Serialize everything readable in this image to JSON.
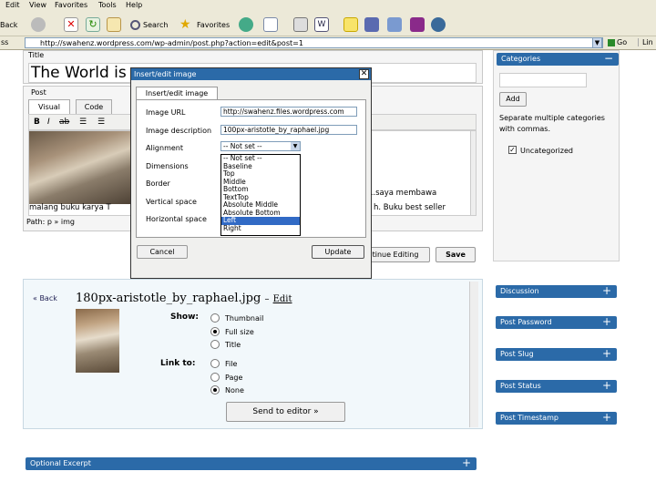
{
  "menubar": [
    "Edit",
    "View",
    "Favorites",
    "Tools",
    "Help"
  ],
  "toolbar": {
    "back_label": "Back",
    "search_label": "Search",
    "favorites_label": "Favorites",
    "go_label": "Go",
    "links_label": "Lin"
  },
  "address": {
    "label": "ss",
    "url": "http://swahenz.wordpress.com/wp-admin/post.php?action=edit&post=1"
  },
  "editor": {
    "title_label": "Title",
    "post_title": "The World is",
    "post_label": "Post",
    "tab_visual": "Visual",
    "tab_code": "Code",
    "body_line1": "...saya membawa",
    "body_line2": "malang buku karya T",
    "body_line3": "h. Buku best seller",
    "path_label": "Path: p » img",
    "continue_btn": "tinue Editing",
    "save_btn": "Save"
  },
  "dialog": {
    "title": "Insert/edit image",
    "tab": "Insert/edit image",
    "labels": [
      "Image URL",
      "Image description",
      "Alignment",
      "Dimensions",
      "Border",
      "Vertical space",
      "Horizontal space"
    ],
    "image_url": "http://swahenz.files.wordpress.com",
    "image_desc": "100px-aristotle_by_raphael.jpg",
    "alignment_value": "-- Not set --",
    "alignment_options": [
      "-- Not set --",
      "Baseline",
      "Top",
      "Middle",
      "Bottom",
      "TextTop",
      "Absolute Middle",
      "Absolute Bottom",
      "Left",
      "Right"
    ],
    "alignment_selected": 8,
    "cancel": "Cancel",
    "update": "Update"
  },
  "uploader": {
    "back": "« Back",
    "filename": "180px-aristotle_by_raphael.jpg",
    "dash": "–",
    "edit": "Edit",
    "show_label": "Show:",
    "show_options": [
      "Thumbnail",
      "Full size",
      "Title"
    ],
    "link_label": "Link to:",
    "link_options": [
      "File",
      "Page",
      "None"
    ],
    "send": "Send to editor »"
  },
  "sidebar": {
    "categories": "Categories",
    "add": "Add",
    "hint": "Separate multiple categories with commas.",
    "uncategorized": "Uncategorized",
    "boxes": [
      "Discussion",
      "Post Password",
      "Post Slug",
      "Post Status",
      "Post Timestamp"
    ]
  },
  "excerpt": "Optional Excerpt",
  "colors": {
    "wp_blue": "#2b6aa8",
    "chrome": "#ece9d8",
    "select_blue": "#316ac5"
  }
}
